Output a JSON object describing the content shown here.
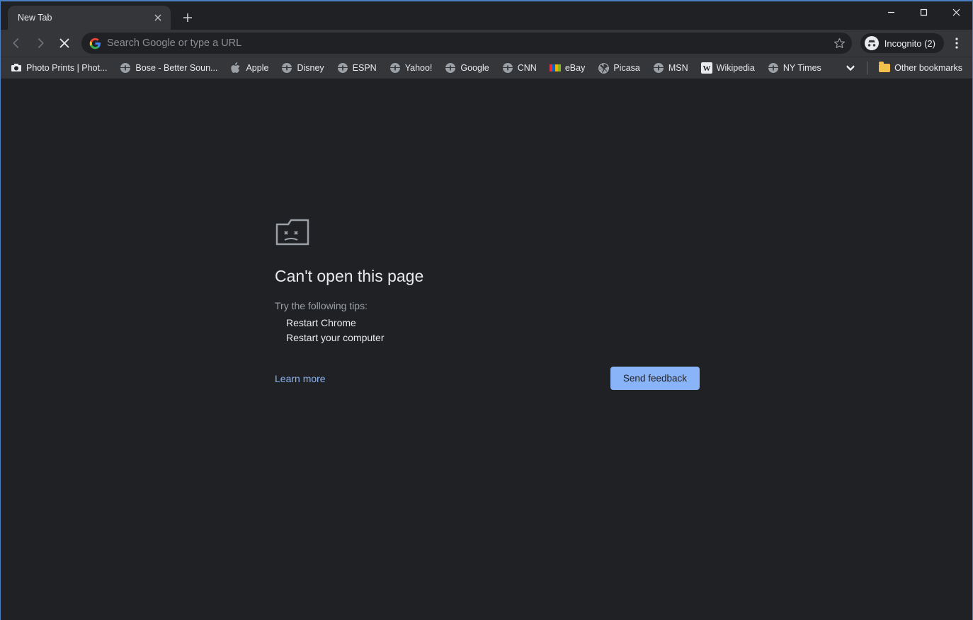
{
  "tab": {
    "title": "New Tab"
  },
  "omnibox": {
    "placeholder": "Search Google or type a URL"
  },
  "incognito": {
    "label": "Incognito (2)"
  },
  "bookmarks": [
    {
      "label": "Photo Prints | Phot...",
      "icon": "photo"
    },
    {
      "label": "Bose - Better Soun...",
      "icon": "globe"
    },
    {
      "label": "Apple",
      "icon": "apple"
    },
    {
      "label": "Disney",
      "icon": "globe"
    },
    {
      "label": "ESPN",
      "icon": "globe"
    },
    {
      "label": "Yahoo!",
      "icon": "globe"
    },
    {
      "label": "Google",
      "icon": "globe"
    },
    {
      "label": "CNN",
      "icon": "globe"
    },
    {
      "label": "eBay",
      "icon": "ebay"
    },
    {
      "label": "Picasa",
      "icon": "picasa"
    },
    {
      "label": "MSN",
      "icon": "globe"
    },
    {
      "label": "Wikipedia",
      "icon": "wiki"
    },
    {
      "label": "NY Times",
      "icon": "globe"
    }
  ],
  "other_bookmarks_label": "Other bookmarks",
  "error": {
    "title": "Can't open this page",
    "subtitle": "Try the following tips:",
    "tips": [
      "Restart Chrome",
      "Restart your computer"
    ],
    "learn_more": "Learn more",
    "feedback": "Send feedback"
  }
}
